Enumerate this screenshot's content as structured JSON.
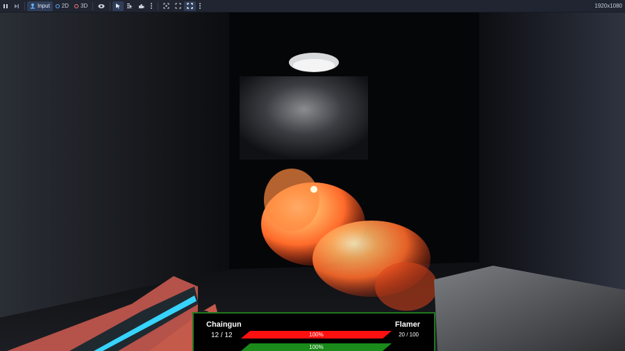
{
  "toolbar": {
    "input_label": "Input",
    "view_2d_label": "2D",
    "view_3d_label": "3D",
    "resolution": "1920x1080",
    "colors": {
      "bg": "#202531",
      "active": "#2f3d57",
      "dot_2d": "#5fb0ff",
      "dot_3d": "#ff7b7b"
    }
  },
  "hud": {
    "left_weapon": {
      "name": "Chaingun",
      "ammo": "12 / 12"
    },
    "right_weapon": {
      "name": "Flamer",
      "ammo": "20 / 100"
    },
    "bars": [
      {
        "label": "100%",
        "value": 100,
        "color": "#ff1010"
      },
      {
        "label": "100%",
        "value": 100,
        "color": "#1a8a1a"
      }
    ],
    "border_color": "#1f7a1f"
  }
}
